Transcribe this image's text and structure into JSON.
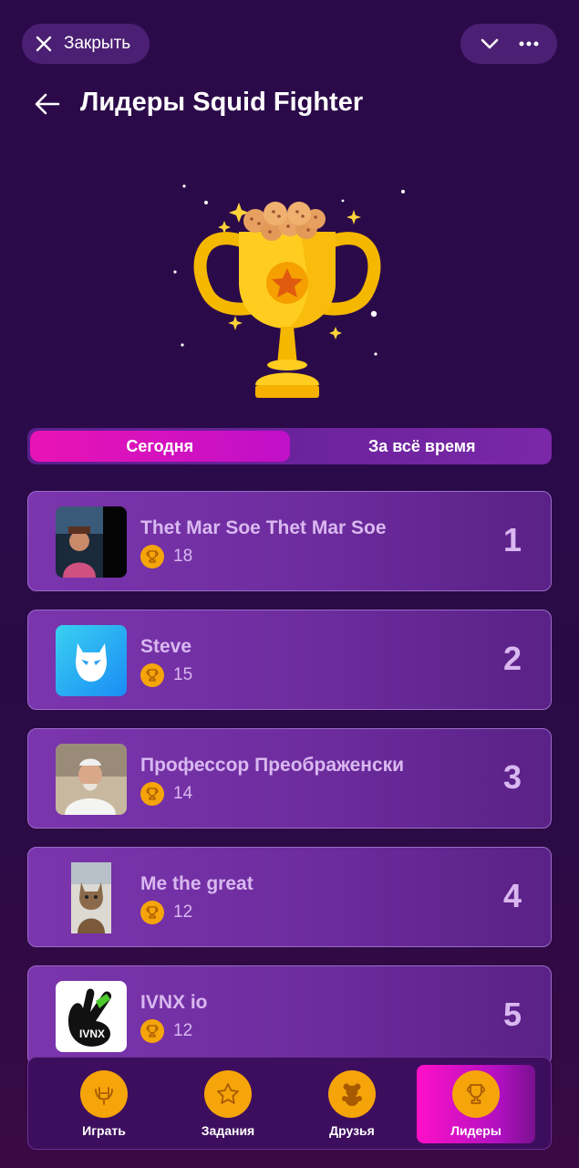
{
  "topbar": {
    "close_label": "Закрыть",
    "close_icon": "close-icon",
    "chevron_icon": "chevron-down-icon",
    "more_icon": "more-horizontal-icon"
  },
  "header": {
    "title": "Лидеры Squid Fighter",
    "back_icon": "arrow-left-icon"
  },
  "hero": {
    "icon": "trophy-with-cookies-icon"
  },
  "tabs": [
    {
      "label": "Сегодня",
      "active": true
    },
    {
      "label": "За всё время",
      "active": false
    }
  ],
  "leaders": [
    {
      "name": "Thet Mar Soe Thet Mar Soe",
      "score": "18",
      "rank": "1"
    },
    {
      "name": "Steve",
      "score": "15",
      "rank": "2"
    },
    {
      "name": "Профессор Преображенски",
      "score": "14",
      "rank": "3"
    },
    {
      "name": "Me the great",
      "score": "12",
      "rank": "4"
    },
    {
      "name": "IVNX io",
      "score": "12",
      "rank": "5"
    }
  ],
  "nav": [
    {
      "label": "Играть",
      "icon": "game-controller-icon",
      "active": false
    },
    {
      "label": "Задания",
      "icon": "star-icon",
      "active": false
    },
    {
      "label": "Друзья",
      "icon": "teddy-bear-icon",
      "active": false
    },
    {
      "label": "Лидеры",
      "icon": "trophy-icon",
      "active": true
    }
  ],
  "colors": {
    "accent": "#e913b4",
    "coin": "#f5a50a",
    "card": "#7b35ad",
    "background": "#2c0a4a"
  }
}
